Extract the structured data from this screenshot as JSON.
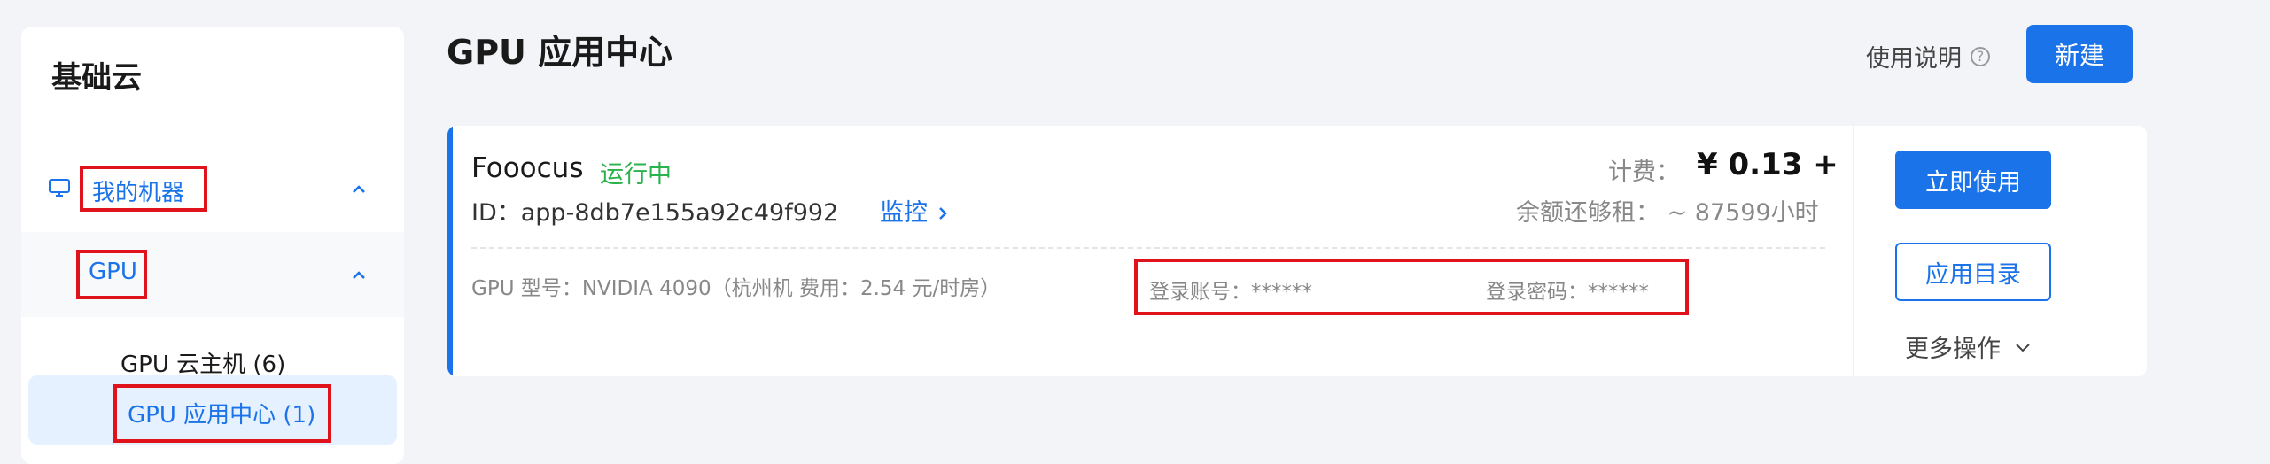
{
  "sidebar": {
    "title": "基础云",
    "items": [
      {
        "label": "我的机器",
        "icon": "monitor-icon"
      },
      {
        "label": "GPU"
      },
      {
        "label": "GPU 云主机 (6)"
      },
      {
        "label": "GPU 应用中心 (1)"
      }
    ]
  },
  "header": {
    "title": "GPU 应用中心",
    "help_label": "使用说明",
    "help_icon": "?",
    "new_label": "新建"
  },
  "card": {
    "name": "Fooocus",
    "status": "运行中",
    "id_text": "ID：app-8db7e155a92c49f992",
    "monitor_label": "监控",
    "fee_label": "计费：",
    "fee_value": "¥ 0.13 +",
    "balance_text": "余额还够租：  ~ 87599小时",
    "gpu_info": "GPU 型号：NVIDIA 4090（杭州机  费用：2.54 元/时房）",
    "login_account": "登录账号：******",
    "login_password": "登录密码：******",
    "use_label": "立即使用",
    "dir_label": "应用目录",
    "more_label": "更多操作"
  },
  "colors": {
    "accent": "#1a73e8",
    "status_green": "#2ab24c",
    "highlight_red": "#e0131c"
  }
}
